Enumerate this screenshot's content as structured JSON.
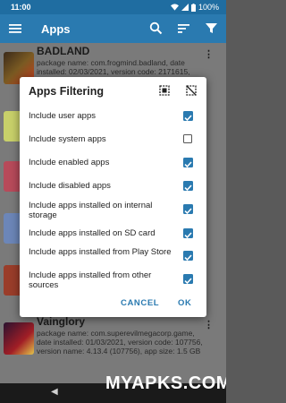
{
  "status": {
    "time": "11:00",
    "battery": "100%"
  },
  "appbar": {
    "title": "Apps"
  },
  "list": [
    {
      "name": "BADLAND",
      "info": "package name: com.frogmind.badland, date installed: 02/03/2021, version code: 2171615, version name: 3.2.0.45, app size"
    },
    {
      "name": "Vainglory",
      "info": "package name: com.superevilmegacorp.game, date installed: 01/03/2021, version code: 107756, version name: 4.13.4 (107756), app size: 1.5 GB"
    }
  ],
  "dialog": {
    "title": "Apps Filtering",
    "options": [
      {
        "label": "Include user apps",
        "checked": true
      },
      {
        "label": "Include system apps",
        "checked": false
      },
      {
        "label": "Include enabled apps",
        "checked": true
      },
      {
        "label": "Include disabled apps",
        "checked": true
      },
      {
        "label": "Include apps installed on internal storage",
        "checked": true
      },
      {
        "label": "Include apps installed on SD card",
        "checked": true
      },
      {
        "label": "Include apps installed from Play Store",
        "checked": true
      },
      {
        "label": "Include apps installed from other sources",
        "checked": true
      }
    ],
    "cancel": "CANCEL",
    "ok": "OK"
  },
  "watermark": "MYAPKS.COM",
  "colors": {
    "primary": "#2a7ab0",
    "statusbar": "#1f6da1",
    "checkbox": "#2a7ab0"
  }
}
